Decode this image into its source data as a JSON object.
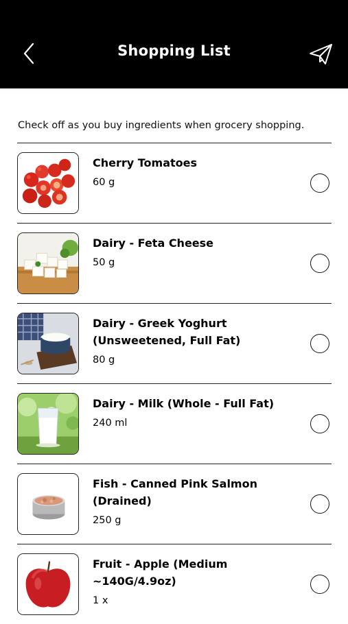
{
  "header": {
    "title": "Shopping List",
    "back_icon": "chevron-left-icon",
    "share_icon": "paper-plane-icon"
  },
  "intro": "Check off as you buy ingredients when grocery shopping.",
  "items": [
    {
      "name": "Cherry Tomatoes",
      "qty": "60 g",
      "image": "cherry-tomatoes",
      "checked": false
    },
    {
      "name": "Dairy - Feta Cheese",
      "qty": "50 g",
      "image": "feta-cheese",
      "checked": false
    },
    {
      "name": "Dairy - Greek Yoghurt (Unsweetened, Full Fat)",
      "qty": "80 g",
      "image": "greek-yoghurt",
      "checked": false
    },
    {
      "name": "Dairy - Milk (Whole - Full Fat)",
      "qty": "240 ml",
      "image": "glass-of-milk",
      "checked": false
    },
    {
      "name": "Fish - Canned Pink Salmon (Drained)",
      "qty": "250 g",
      "image": "canned-salmon",
      "checked": false
    },
    {
      "name": "Fruit - Apple (Medium ~140G/4.9oz)",
      "qty": "1 x",
      "image": "red-apple",
      "checked": false
    }
  ]
}
